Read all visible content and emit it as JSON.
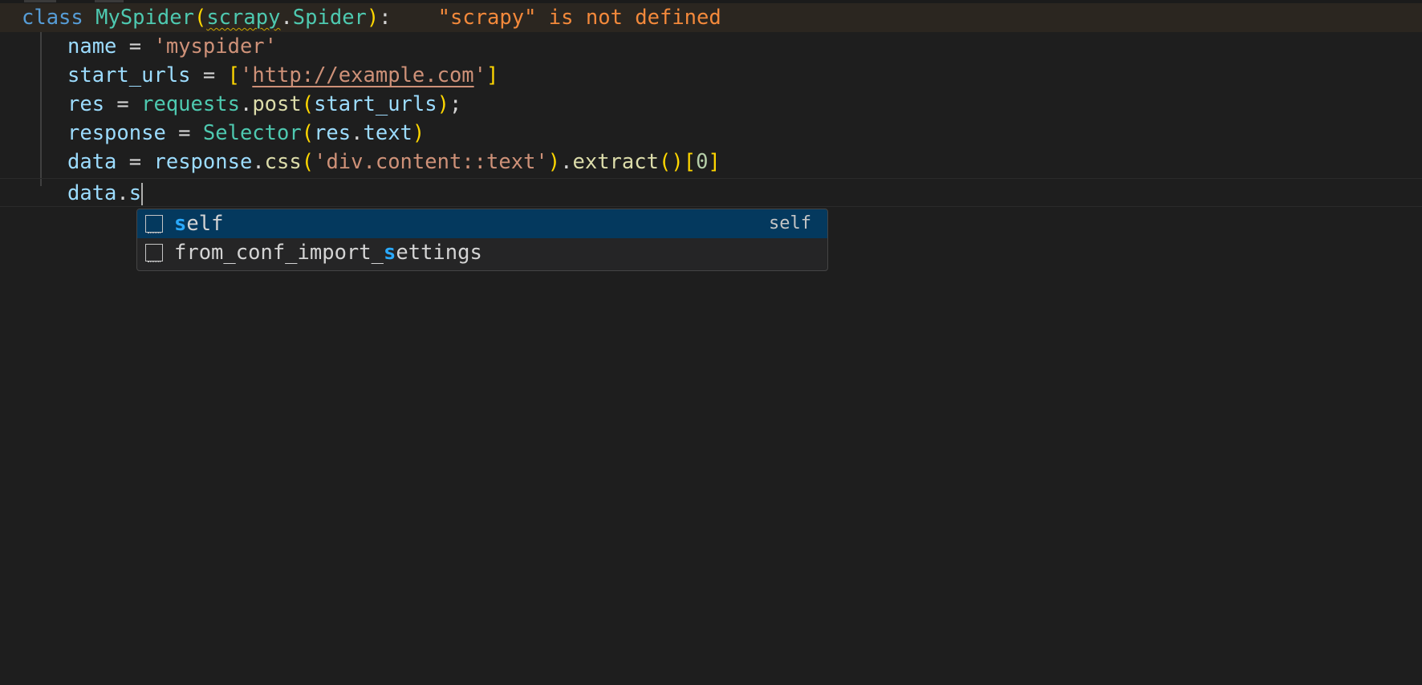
{
  "editor": {
    "lines": [
      {
        "tokens": {
          "kw_class": "class",
          "class_name": "MySpider",
          "paren_open": "(",
          "base_module": "scrapy",
          "dot": ".",
          "base_class": "Spider",
          "paren_close": ")",
          "colon": ":"
        },
        "diagnostic": "\"scrapy\" is not defined"
      },
      {
        "var": "name",
        "op": " = ",
        "str": "'myspider'"
      },
      {
        "var": "start_urls",
        "op": " = ",
        "bracket_open": "[",
        "quote_open": "'",
        "url": "http://example.com",
        "quote_close": "'",
        "bracket_close": "]"
      },
      {
        "var": "res",
        "op": " = ",
        "module": "requests",
        "dot": ".",
        "fn": "post",
        "paren_open": "(",
        "arg": "start_urls",
        "paren_close": ")",
        "semi": ";"
      },
      {
        "var": "response",
        "op": " = ",
        "cls": "Selector",
        "paren_open": "(",
        "arg_obj": "res",
        "dot": ".",
        "arg_attr": "text",
        "paren_close": ")"
      },
      {
        "var": "data",
        "op": " = ",
        "obj": "response",
        "dot1": ".",
        "fn1": "css",
        "paren_open1": "(",
        "str": "'div.content::text'",
        "paren_close1": ")",
        "dot2": ".",
        "fn2": "extract",
        "paren_open2": "(",
        "paren_close2": ")",
        "bracket_open": "[",
        "index": "0",
        "bracket_close": "]"
      },
      {
        "var": "data",
        "dot": ".",
        "typed": "s"
      }
    ]
  },
  "suggestions": {
    "items": [
      {
        "match": "s",
        "rest": "elf",
        "detail": "self",
        "icon": "variable-icon",
        "selected": true
      },
      {
        "prefix": "from_conf_import_",
        "match": "s",
        "rest": "ettings",
        "icon": "variable-icon",
        "selected": false
      }
    ]
  },
  "colors": {
    "background": "#1e1e1e",
    "keyword": "#569cd6",
    "class": "#4ec9b0",
    "function": "#dcdcaa",
    "variable": "#9cdcfe",
    "string": "#ce9178",
    "number": "#b5cea8",
    "diagnostic": "#f3893b",
    "selection": "#04395e",
    "match_highlight": "#2aaaff"
  }
}
